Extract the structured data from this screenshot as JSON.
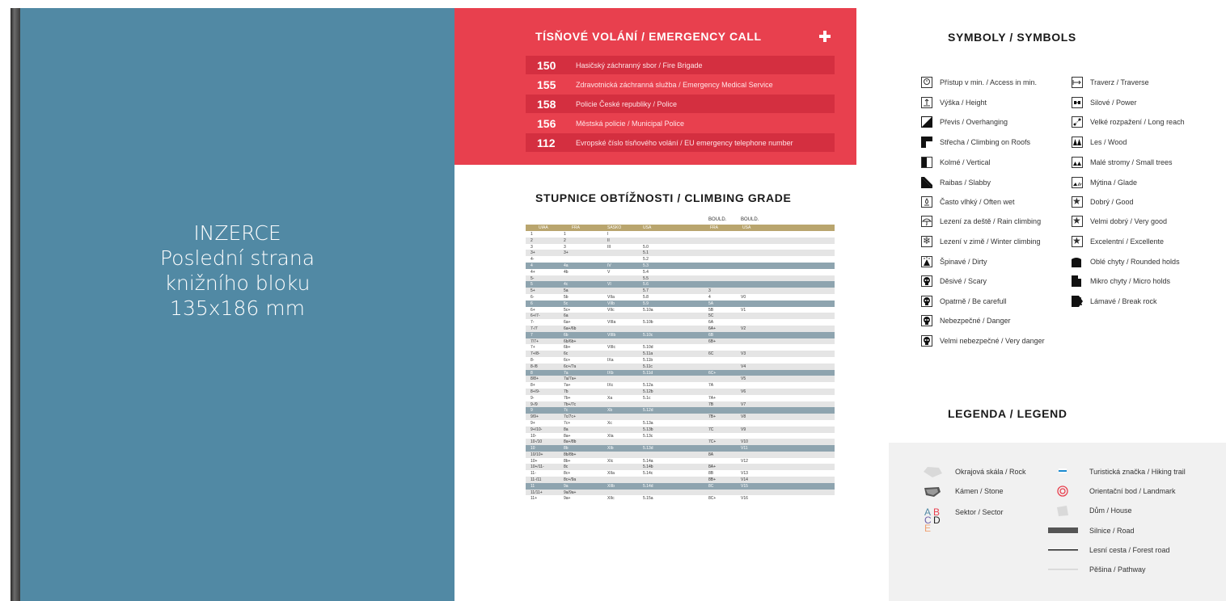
{
  "ad": {
    "lines": [
      "INZERCE",
      "Poslední strana",
      "knižního bloku",
      "135x186 mm"
    ]
  },
  "emergency": {
    "title": "TÍSŇOVÉ VOLÁNÍ / EMERGENCY CALL",
    "rows": [
      {
        "num": "150",
        "desc": "Hasičský záchranný sbor / Fire Brigade"
      },
      {
        "num": "155",
        "desc": "Zdravotnická záchranná služba / Emergency Medical Service"
      },
      {
        "num": "158",
        "desc": "Policie České republiky / Police"
      },
      {
        "num": "156",
        "desc": "Městská policie / Municipal Police"
      },
      {
        "num": "112",
        "desc": "Evropské číslo tísňového volání / EU emergency telephone number"
      }
    ]
  },
  "grades": {
    "title": "STUPNICE OBTÍŽNOSTI / CLIMBING GRADE",
    "top_labels": [
      "BOULD.",
      "BOULD."
    ],
    "headers": [
      "UIAA",
      "FRA",
      "SASKO",
      "USA",
      "FRA",
      "USA"
    ],
    "rows": [
      [
        "1",
        "1",
        "I",
        "",
        "",
        ""
      ],
      [
        "2",
        "2",
        "II",
        "",
        "",
        ""
      ],
      [
        "3",
        "3",
        "III",
        "5.0",
        "",
        ""
      ],
      [
        "3+",
        "3+",
        "",
        "5.1",
        "",
        ""
      ],
      [
        "4-",
        "",
        "",
        "5.2",
        "",
        ""
      ],
      [
        "4",
        "4a",
        "IV",
        "5.3",
        "",
        ""
      ],
      [
        "4+",
        "4b",
        "V",
        "5.4",
        "",
        ""
      ],
      [
        "5-",
        "",
        "",
        "5.5",
        "",
        ""
      ],
      [
        "5",
        "4c",
        "VI",
        "5.6",
        "",
        ""
      ],
      [
        "5+",
        "5a",
        "",
        "5.7",
        "3",
        ""
      ],
      [
        "6-",
        "5b",
        "VIIa",
        "5.8",
        "4",
        "V0"
      ],
      [
        "6",
        "5c",
        "VIIb",
        "5.9",
        "5A",
        ""
      ],
      [
        "6+",
        "5c+",
        "VIIc",
        "5.10a",
        "5B",
        "V1"
      ],
      [
        "6+/7-",
        "6a",
        "",
        "",
        "5C",
        ""
      ],
      [
        "7-",
        "6a+",
        "VIIIa",
        "5.10b",
        "6A",
        ""
      ],
      [
        "7-/7",
        "6a+/6b",
        "",
        "",
        "6A+",
        "V2"
      ],
      [
        "7",
        "6b",
        "VIIIb",
        "5.10c",
        "6B",
        ""
      ],
      [
        "7/7+",
        "6b/6b+",
        "",
        "",
        "6B+",
        ""
      ],
      [
        "7+",
        "6b+",
        "VIIIc",
        "5.10d",
        "",
        ""
      ],
      [
        "7+/8-",
        "6c",
        "",
        "5.11a",
        "6C",
        "V3"
      ],
      [
        "8-",
        "6c+",
        "IXa",
        "5.11b",
        "",
        ""
      ],
      [
        "8-/8",
        "6c+/7a",
        "",
        "5.11c",
        "",
        "V4"
      ],
      [
        "8",
        "7a",
        "IXb",
        "5.11d",
        "6C+",
        ""
      ],
      [
        "8/8+",
        "7a/7a+",
        "",
        "",
        "",
        "V5"
      ],
      [
        "8+",
        "7a+",
        "IXc",
        "5.12a",
        "7A",
        ""
      ],
      [
        "8+/9-",
        "7b",
        "",
        "5.12b",
        "",
        "V6"
      ],
      [
        "9-",
        "7b+",
        "Xa",
        "5.1c",
        "7A+",
        ""
      ],
      [
        "9-/9",
        "7b+/7c",
        "",
        "",
        "7B",
        "V7"
      ],
      [
        "9",
        "7c",
        "Xb",
        "5.12d",
        "",
        ""
      ],
      [
        "9/9+",
        "7c/7c+",
        "",
        "",
        "7B+",
        "V8"
      ],
      [
        "9+",
        "7c+",
        "Xc",
        "5.13a",
        "",
        ""
      ],
      [
        "9+/10-",
        "8a",
        "",
        "5.13b",
        "7C",
        "V9"
      ],
      [
        "10-",
        "8a+",
        "XIa",
        "5.13c",
        "",
        ""
      ],
      [
        "10-/10",
        "8a+/8b",
        "",
        "",
        "7C+",
        "V10"
      ],
      [
        "10",
        "8b",
        "XIb",
        "5.13d",
        "",
        "V11"
      ],
      [
        "10/10+",
        "8b/8b+",
        "",
        "",
        "8A",
        ""
      ],
      [
        "10+",
        "8b+",
        "XIc",
        "5.14a",
        "",
        "V12"
      ],
      [
        "10+/11-",
        "8c",
        "",
        "5.14b",
        "8A+",
        ""
      ],
      [
        "11-",
        "8c+",
        "XIIa",
        "5.14c",
        "8B",
        "V13"
      ],
      [
        "11-/11",
        "8c+/9a",
        "",
        "",
        "8B+",
        "V14"
      ],
      [
        "11",
        "9a",
        "XIIb",
        "5.14d",
        "8C",
        "V15"
      ],
      [
        "11/11+",
        "9a/9a+",
        "",
        "",
        "",
        ""
      ],
      [
        "11+",
        "9a+",
        "XIIc",
        "5.15a",
        "8C+",
        "V16"
      ]
    ]
  },
  "symbols": {
    "title": "SYMBOLY / SYMBOLS",
    "left": [
      "Přístup v min. / Access in min.",
      "Výška / Height",
      "Převis / Overhanging",
      "Střecha / Climbing on Roofs",
      "Kolmé / Vertical",
      "Raibas / Slabby",
      "Často vlhký / Often wet",
      "Lezení za deště / Rain climbing",
      "Lezení v zimě / Winter climbing",
      "Špinavé / Dirty",
      "Děsivé / Scary",
      "Opatrně / Be carefull",
      "Nebezpečné / Danger",
      "Velmi nebezpečné / Very danger"
    ],
    "right": [
      "Traverz / Traverse",
      "Silové / Power",
      "Velké rozpažení / Long reach",
      "Les / Wood",
      "Malé stromy / Small trees",
      "Mýtina / Glade",
      "Dobrý / Good",
      "Velmi dobrý / Very good",
      "Excelentní / Excellente",
      "Oblé chyty / Rounded holds",
      "Mikro chyty / Micro holds",
      "Lámavé / Break rock"
    ]
  },
  "legend": {
    "title": "LEGENDA / LEGEND",
    "left": [
      "Okrajová skála / Rock",
      "Kámen / Stone",
      "Sektor / Sector"
    ],
    "sector_letters": [
      "A",
      "B",
      "C",
      "D",
      "E"
    ],
    "right": [
      "Turistická značka / Hiking trail",
      "Orientační bod / Landmark",
      "Dům / House",
      "Silnice / Road",
      "Lesní cesta / Forest road",
      "Pěšina / Pathway"
    ]
  },
  "colors": {
    "ad_blue": "#5189a4",
    "emergency_red": "#e8404e",
    "grade_header": "#b9a56e",
    "grade_highlight": "#8ea4af"
  }
}
